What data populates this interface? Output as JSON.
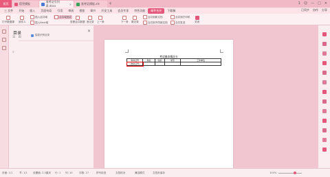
{
  "titlebar": {
    "home_tab": "首页",
    "tabs": [
      {
        "label": "稻壳模板",
        "icon": "docer-icon",
        "color": "#e4567a"
      },
      {
        "label": "准考证号列表.docx",
        "icon": "word-icon",
        "color": "#4a78d6"
      },
      {
        "label": "准考证模板.xls",
        "icon": "excel-icon",
        "color": "#3aa35b"
      }
    ],
    "new_tab": "+",
    "right_icons": [
      "1",
      "☺",
      "—",
      "□",
      "✕"
    ]
  },
  "menubar": {
    "items": [
      "三 文件",
      "开始",
      "插入",
      "页面布局",
      "引用",
      "审阅",
      "视图",
      "章节",
      "开发工具",
      "会员专享",
      "特色功能",
      "邮件合并",
      "下载稿"
    ],
    "active_index": 11,
    "right": [
      "已同步",
      "协作",
      "分享"
    ]
  },
  "toolbar": {
    "buttons": [
      "打开数据源",
      "收件人",
      "插入合并域",
      "插入Next域",
      "合并域底纹",
      "查看合并数据",
      "首记录",
      "上一条",
      "下一条",
      "尾记录",
      "合并到新文档",
      "合并到不同新文档",
      "合并到打印机",
      "合并发送",
      "关闭"
    ]
  },
  "nav": {
    "title": "目录",
    "close": "✕",
    "item": "智能识别目录",
    "tools": [
      "☰",
      "⊞"
    ],
    "search": "⌕"
  },
  "document": {
    "title": "考试基本情况卡",
    "headers": [
      "准考证号",
      "姓名",
      "性别",
      "学历",
      "工作单位"
    ],
    "selected_cell": "«准考证号»"
  },
  "rightrail": {
    "items": [
      "",
      "",
      "",
      "",
      "",
      "",
      "",
      "",
      "",
      "",
      "",
      "",
      ""
    ]
  },
  "statusbar": {
    "items": [
      "页面: 1/1",
      "节: 1/1",
      "设置值: 2.5厘米",
      "行: 1",
      "列: 10",
      "字数: 27",
      "拼写检查",
      "文档校对",
      "兼容模式",
      "文档未保存"
    ],
    "zoom": "100%"
  }
}
